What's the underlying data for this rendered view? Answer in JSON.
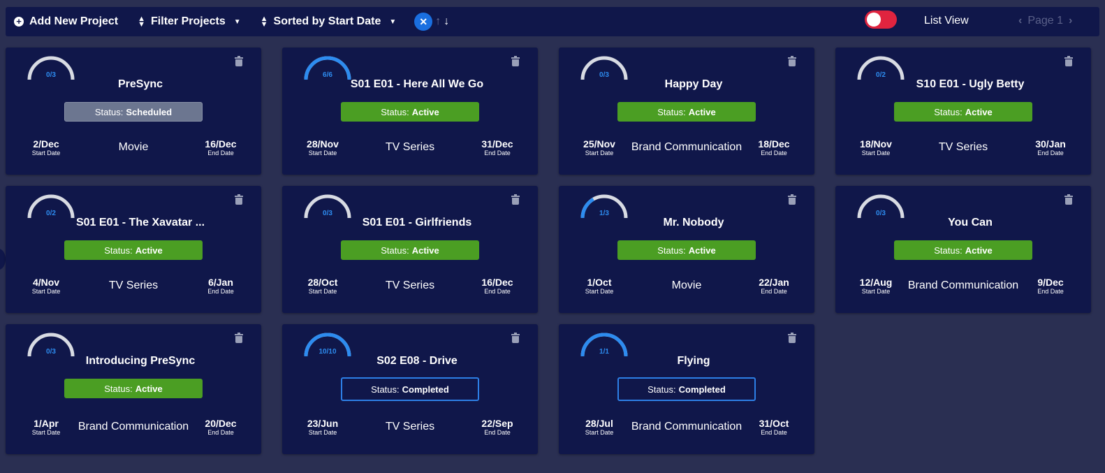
{
  "toolbar": {
    "add_label": "Add New Project",
    "filter_label": "Filter Projects",
    "sort_label": "Sorted by Start Date",
    "list_view_label": "List View",
    "page_label": "Page 1"
  },
  "colors": {
    "background": "#2a2f52",
    "card": "#10174a",
    "active": "#4b9e23",
    "scheduled": "#6c7690",
    "completed_border": "#2d7fe6",
    "gauge_fill": "#2d8cf0",
    "toggle": "#e0243f"
  },
  "projects": [
    {
      "title": "PreSync",
      "done": 0,
      "total": 3,
      "progress_label": "0/3",
      "status_prefix": "Status:",
      "status": "Scheduled",
      "start": "2/Dec",
      "start_label": "Start Date",
      "type": "Movie",
      "end": "16/Dec",
      "end_label": "End Date"
    },
    {
      "title": "S01 E01 - Here All We Go",
      "done": 6,
      "total": 6,
      "progress_label": "6/6",
      "status_prefix": "Status:",
      "status": "Active",
      "start": "28/Nov",
      "start_label": "Start Date",
      "type": "TV Series",
      "end": "31/Dec",
      "end_label": "End Date"
    },
    {
      "title": "Happy Day",
      "done": 0,
      "total": 3,
      "progress_label": "0/3",
      "status_prefix": "Status:",
      "status": "Active",
      "start": "25/Nov",
      "start_label": "Start Date",
      "type": "Brand Communication",
      "end": "18/Dec",
      "end_label": "End Date"
    },
    {
      "title": "S10 E01 - Ugly Betty",
      "done": 0,
      "total": 2,
      "progress_label": "0/2",
      "status_prefix": "Status:",
      "status": "Active",
      "start": "18/Nov",
      "start_label": "Start Date",
      "type": "TV Series",
      "end": "30/Jan",
      "end_label": "End Date"
    },
    {
      "title": "S01 E01 - The Xavatar ...",
      "done": 0,
      "total": 2,
      "progress_label": "0/2",
      "status_prefix": "Status:",
      "status": "Active",
      "start": "4/Nov",
      "start_label": "Start Date",
      "type": "TV Series",
      "end": "6/Jan",
      "end_label": "End Date"
    },
    {
      "title": "S01 E01 - Girlfriends",
      "done": 0,
      "total": 3,
      "progress_label": "0/3",
      "status_prefix": "Status:",
      "status": "Active",
      "start": "28/Oct",
      "start_label": "Start Date",
      "type": "TV Series",
      "end": "16/Dec",
      "end_label": "End Date"
    },
    {
      "title": "Mr. Nobody",
      "done": 1,
      "total": 3,
      "progress_label": "1/3",
      "status_prefix": "Status:",
      "status": "Active",
      "start": "1/Oct",
      "start_label": "Start Date",
      "type": "Movie",
      "end": "22/Jan",
      "end_label": "End Date"
    },
    {
      "title": "You Can",
      "done": 0,
      "total": 3,
      "progress_label": "0/3",
      "status_prefix": "Status:",
      "status": "Active",
      "start": "12/Aug",
      "start_label": "Start Date",
      "type": "Brand Communication",
      "end": "9/Dec",
      "end_label": "End Date"
    },
    {
      "title": "Introducing PreSync",
      "done": 0,
      "total": 3,
      "progress_label": "0/3",
      "status_prefix": "Status:",
      "status": "Active",
      "start": "1/Apr",
      "start_label": "Start Date",
      "type": "Brand Communication",
      "end": "20/Dec",
      "end_label": "End Date"
    },
    {
      "title": "S02 E08 - Drive",
      "done": 10,
      "total": 10,
      "progress_label": "10/10",
      "status_prefix": "Status:",
      "status": "Completed",
      "start": "23/Jun",
      "start_label": "Start Date",
      "type": "TV Series",
      "end": "22/Sep",
      "end_label": "End Date"
    },
    {
      "title": "Flying",
      "done": 1,
      "total": 1,
      "progress_label": "1/1",
      "status_prefix": "Status:",
      "status": "Completed",
      "start": "28/Jul",
      "start_label": "Start Date",
      "type": "Brand Communication",
      "end": "31/Oct",
      "end_label": "End Date"
    }
  ]
}
